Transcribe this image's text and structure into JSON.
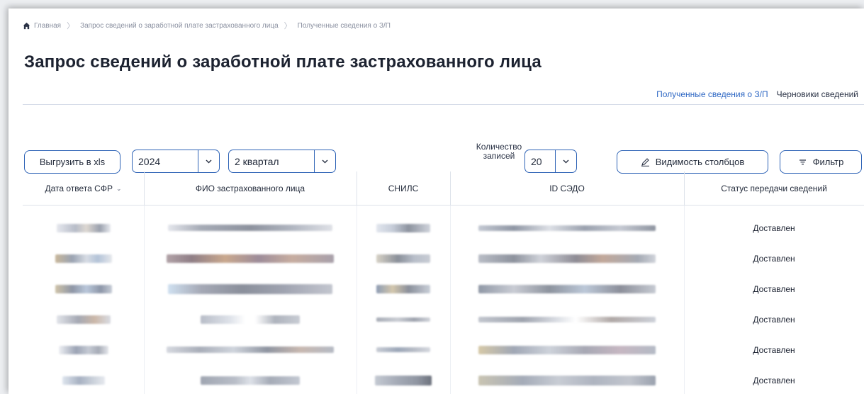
{
  "breadcrumb": {
    "home": "Главная",
    "level1": "Запрос сведений о заработной плате застрахованного лица",
    "level2": "Полученные сведения о З/П"
  },
  "page_title": "Запрос сведений о заработной плате застрахованного лица",
  "tabs": {
    "received": "Полученные сведения о З/П",
    "drafts": "Черновики сведений"
  },
  "toolbar": {
    "export_label": "Выгрузить в xls",
    "year_value": "2024",
    "quarter_value": "2 квартал",
    "count_label_line1": "Количество",
    "count_label_line2": "записей",
    "count_value": "20",
    "columns_label": "Видимость столбцов",
    "filter_label": "Фильтр"
  },
  "table": {
    "headers": {
      "date": "Дата ответа СФР",
      "fio": "ФИО застрахованного лица",
      "snils": "СНИЛС",
      "sedo": "ID СЭДО",
      "status": "Статус передачи сведений"
    },
    "rows": [
      {
        "status": "Доставлен"
      },
      {
        "status": "Доставлен"
      },
      {
        "status": "Доставлен"
      },
      {
        "status": "Доставлен"
      },
      {
        "status": "Доставлен"
      },
      {
        "status": "Доставлен"
      }
    ]
  },
  "colors": {
    "accent": "#2e63b6",
    "active_tab": "#2f68c4",
    "text": "#1e2433",
    "muted": "#8a90a0"
  }
}
